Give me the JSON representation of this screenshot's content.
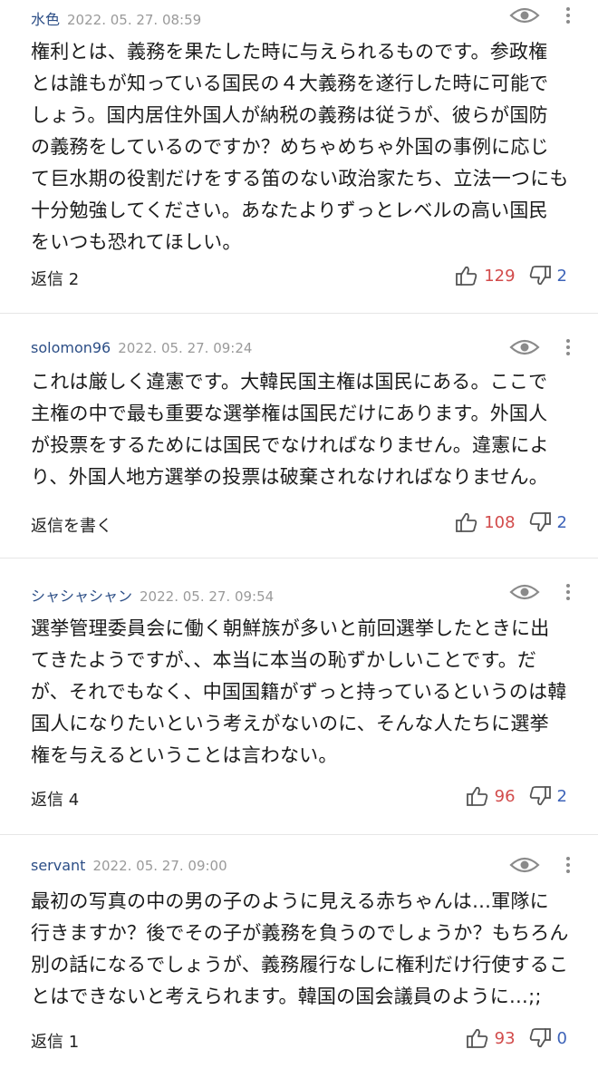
{
  "comments": [
    {
      "nickname": "水色",
      "timestamp": "2022. 05. 27. 08:59",
      "body": "権利とは、義務を果たした時に与えられるものです。参政権\nとは誰もが知っている国民の４大義務を遂行した時に可能で\nしょう。国内居住外国人が納税の義務は従うが、彼らが国防\nの義務をしているのですか？めちゃめちゃ外国の事例に応じ\nて巨水期の役割だけをする笛のない政治家たち、立法一つにも\n十分勉強してください。あなたよりずっとレベルの高い国民\nをいつも恐れてほしい。",
      "reply_label": "返信 2",
      "likes": "129",
      "dislikes": "2"
    },
    {
      "nickname": "solomon96",
      "timestamp": "2022. 05. 27. 09:24",
      "body": "これは厳しく違憲です。大韓民国主権は国民にある。ここで\n主権の中で最も重要な選挙権は国民だけにあります。外国人\nが投票をするためには国民でなければなりません。違憲によ\nり、外国人地方選挙の投票は破棄されなければなりません。",
      "reply_label": "返信を書く",
      "likes": "108",
      "dislikes": "2"
    },
    {
      "nickname": "シャシャシャン",
      "timestamp": "2022. 05. 27. 09:54",
      "body": "選挙管理委員会に働く朝鮮族が多いと前回選挙したときに出\nてきたようですが、、本当に本当の恥ずかしいことです。だ\nが、それでもなく、中国国籍がずっと持っているというのは韓\n国人になりたいという考えがないのに、そんな人たちに選挙\n権を与えるということは言わない。",
      "reply_label": "返信 4",
      "likes": "96",
      "dislikes": "2"
    },
    {
      "nickname": "servant",
      "timestamp": "2022. 05. 27. 09:00",
      "body": "最初の写真の中の男の子のように見える赤ちゃんは…軍隊に\n行きますか？後でその子が義務を負うのでしょうか？もちろん\n別の話になるでしょうが、義務履行なしに権利だけ行使するこ\nとはできないと考えられます。韓国の国会議員のように…;;",
      "reply_label": "返信 1",
      "likes": "93",
      "dislikes": "0"
    }
  ]
}
